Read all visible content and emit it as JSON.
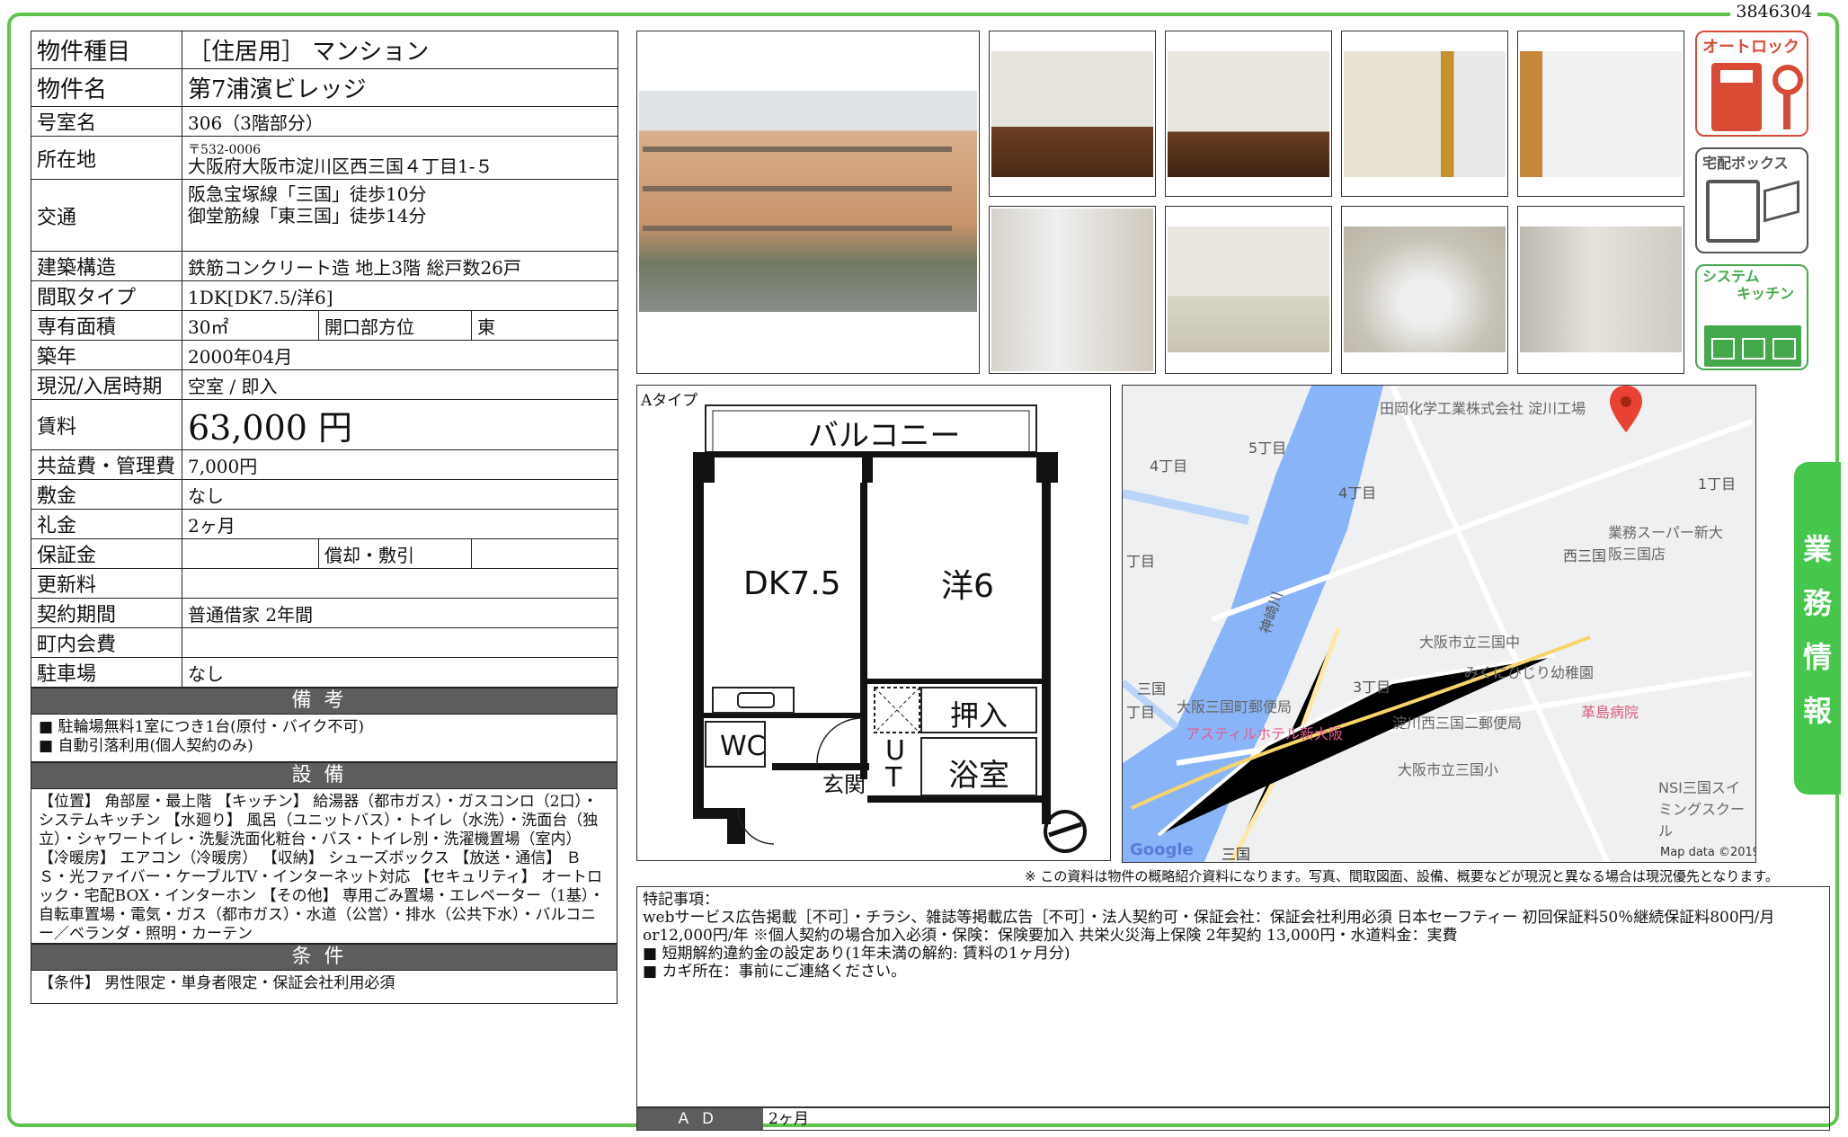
{
  "doc_number": "3846304",
  "spec": {
    "type_label": "物件種目",
    "type_value": "［住居用］ マンション",
    "name_label": "物件名",
    "name_value": "第7浦濱ビレッジ",
    "room_label": "号室名",
    "room_value": "306（3階部分）",
    "address_label": "所在地",
    "postal": "〒532-0006",
    "address": "大阪府大阪市淀川区西三国４丁目1-５",
    "transit_label": "交通",
    "transit_1": "阪急宝塚線「三国」徒歩10分",
    "transit_2": "御堂筋線「東三国」徒歩14分",
    "structure_label": "建築構造",
    "structure_value": "鉄筋コンクリート造 地上3階 総戸数26戸",
    "layout_label": "間取タイプ",
    "layout_value": "1DK[DK7.5/洋6]",
    "area_label": "専有面積",
    "area_value": "30㎡",
    "opening_label": "開口部方位",
    "opening_value": "東",
    "built_label": "築年",
    "built_value": "2000年04月",
    "status_label": "現況/入居時期",
    "status_value": "空室 / 即入",
    "rent_label": "賃料",
    "rent_value": "63,000 円",
    "fee_label": "共益費・管理費",
    "fee_value": "7,000円",
    "deposit_label": "敷金",
    "deposit_value": "なし",
    "key_money_label": "礼金",
    "key_money_value": "2ヶ月",
    "guarantee_label": "保証金",
    "guarantee_value": "",
    "amort_label": "償却・敷引",
    "amort_value": "",
    "renewal_label": "更新料",
    "renewal_value": "",
    "contract_label": "契約期間",
    "contract_value": "普通借家 2年間",
    "community_label": "町内会費",
    "community_value": "",
    "parking_label": "駐車場",
    "parking_value": "なし"
  },
  "remarks": {
    "title": "備考",
    "line1": "■ 駐輪場無料1室につき1台(原付・バイク不可)",
    "line2": "■ 自動引落利用(個人契約のみ)"
  },
  "equipment": {
    "title": "設備",
    "text": "【位置】 角部屋・最上階 【キッチン】 給湯器（都市ガス）・ガスコンロ（2口）・システムキッチン 【水廻り】 風呂（ユニットバス）・トイレ（水洗）・洗面台（独立）・シャワートイレ・洗髪洗面化粧台・バス・トイレ別・洗濯機置場（室内） 【冷暖房】 エアコン（冷暖房） 【収納】 シューズボックス 【放送・通信】 ＢＳ・光ファイバー・ケーブルTV・インターネット対応 【セキュリティ】 オートロック・宅配BOX・インターホン 【その他】 専用ごみ置場・エレベーター（1基）・自転車置場・電気・ガス（都市ガス）・水道（公営）・排水（公共下水）・バルコニー／ベランダ・照明・カーテン"
  },
  "conditions": {
    "title": "条件",
    "text": "【条件】 男性限定・単身者限定・保証会社利用必須"
  },
  "badges": {
    "autolock": "オートロック",
    "delivery": "宅配ボックス",
    "system": "システム",
    "kitchen": "キッチン"
  },
  "plan": {
    "type_label": "Aタイプ",
    "balcony": "バルコニー",
    "dk": "DK7.5",
    "western": "洋6",
    "closet": "押入",
    "wc": "WC",
    "ut": "U\nT",
    "bath": "浴室",
    "entrance": "玄関"
  },
  "map": {
    "labels": [
      "田岡化学工業株式会社 淀川工場",
      "5丁目",
      "4丁目",
      "4丁目",
      "1丁目",
      "業務スーパー新大阪三国店",
      "西三国",
      "丁目",
      "三国",
      "大阪市立三国中",
      "みくにひじり幼稚園",
      "3丁目",
      "大阪三国町郵便局",
      "淀川西三国二郵便局",
      "革島病院",
      "アスティルホテル新大阪",
      "大阪市立三国小",
      "NSI三国スイミングスクール",
      "丁目",
      "三国",
      "神崎川"
    ],
    "google": "Google",
    "mapdata": "Map data ©2019"
  },
  "disclaimer": "※ この資料は物件の概略紹介資料になります。写真、間取図面、設備、概要などが現況と異なる場合は現況優先となります。",
  "notes": {
    "title": "特記事項：",
    "line1": "webサービス広告掲載［不可］・チラシ、雑誌等掲載広告［不可］・法人契約可・保証会社：保証会社利用必須 日本セーフティー 初回保証料50％継続保証料800円/月or12,000円/年 ※個人契約の場合加入必須・保険：保険要加入 共栄火災海上保険 2年契約 13,000円・水道料金：実費",
    "line2": "■ 短期解約違約金の設定あり(1年未満の解約: 賃料の1ヶ月分)",
    "line3": "■ カギ所在：事前にご連絡ください。"
  },
  "ad": {
    "label": "ＡＤ",
    "value": "2ヶ月"
  },
  "side_tab": [
    "業",
    "務",
    "情",
    "報"
  ]
}
